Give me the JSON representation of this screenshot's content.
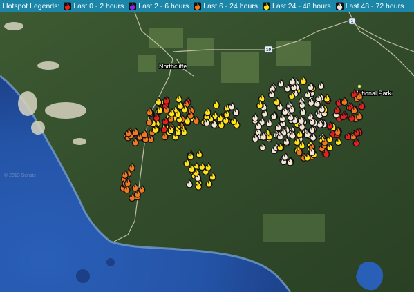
{
  "legend": {
    "title": "Hotspot Legends:",
    "items": [
      {
        "label": "Last 0 - 2 hours",
        "color": "#e8201c",
        "icon": "fire-icon"
      },
      {
        "label": "Last 2 - 6 hours",
        "color": "#8a2be2",
        "icon": "fire-icon"
      },
      {
        "label": "Last 6 - 24 hours",
        "color": "#f07820",
        "icon": "fire-icon"
      },
      {
        "label": "Last 24 - 48 hours",
        "color": "#ffe21a",
        "icon": "fire-icon"
      },
      {
        "label": "Last 48 - 72 hours",
        "color": "#f4e6d6",
        "icon": "fire-icon"
      }
    ]
  },
  "map": {
    "town_label": "Northcliffe",
    "park_label": "National Park",
    "road_shields": [
      "10",
      "1"
    ],
    "watermark": "© 2013 Sensis"
  }
}
